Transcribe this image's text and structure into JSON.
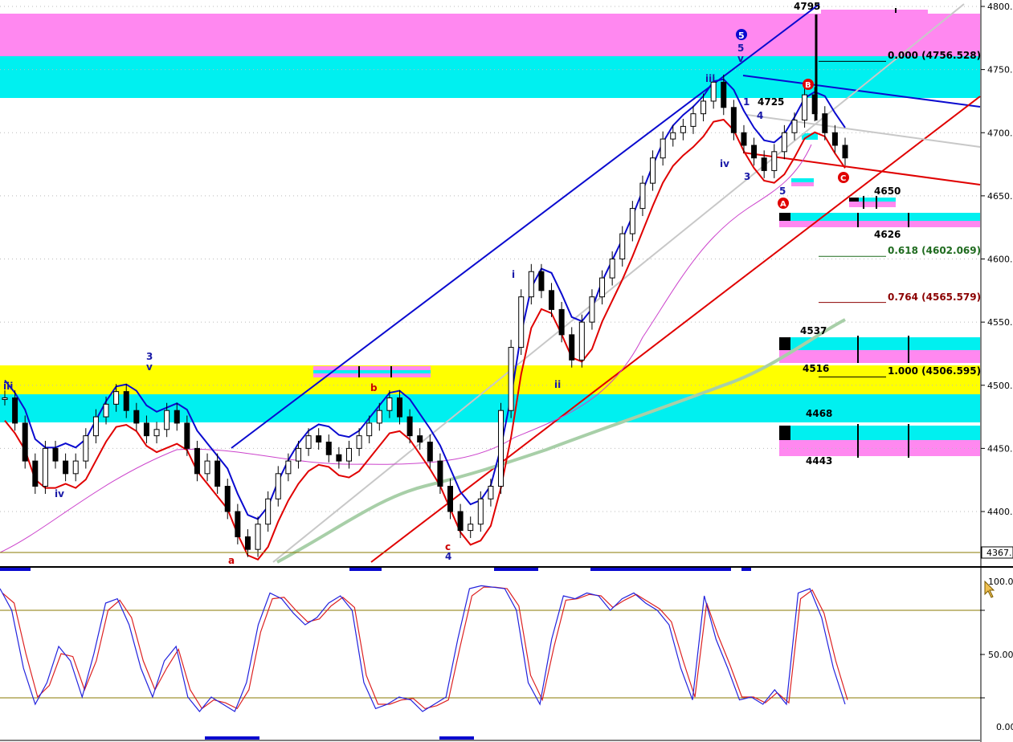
{
  "colors": {
    "magenta": "#ff88f0",
    "cyan": "#00f0f0",
    "yellow": "#ffff00",
    "blue_line": "#0a0acf",
    "red_line": "#e00000",
    "gray_line": "#b8b8b8",
    "green_ma": "#a8cfa8",
    "purple_ma": "#cc44cc",
    "stoch_k": "#2222dd",
    "stoch_d": "#dd2222",
    "ref_line": "#8a7a00"
  },
  "price_axis": {
    "ticks": [
      "4800.",
      "4750.",
      "4700.",
      "4650.",
      "4600.",
      "4550.",
      "4500.",
      "4450.",
      "4400."
    ],
    "current": "4367."
  },
  "osc_axis": {
    "ticks": [
      "100.0",
      "50.00",
      "0.00"
    ]
  },
  "fib_levels": [
    {
      "text": "0.000 (4756.528)",
      "value": 4756.528,
      "color": "#000000"
    },
    {
      "text": "0.618 (4602.069)",
      "value": 4602.069,
      "color": "#1f6b1f"
    },
    {
      "text": "0.764 (4565.579)",
      "value": 4565.579,
      "color": "#8b0000"
    },
    {
      "text": "1.000 (4506.595)",
      "value": 4506.595,
      "color": "#000000"
    }
  ],
  "price_labels": [
    "4795",
    "4725",
    "4650",
    "4626",
    "4537",
    "4516",
    "4468",
    "4443"
  ],
  "wave_labels": {
    "iii_left": "iii",
    "iv_left": "iv",
    "three_top": "3",
    "v_top": "v",
    "a_low": "a",
    "b_mid": "b",
    "c_low": "c",
    "four_low": "4",
    "i": "i",
    "ii": "ii",
    "iii": "iii",
    "five_top": "5",
    "v_right": "v",
    "circle5": "5",
    "iv_right": "iv",
    "one": "1",
    "four": "4",
    "three": "3",
    "five_low": "5",
    "A": "A",
    "B": "B",
    "C": "C"
  },
  "chart_data": {
    "type": "line",
    "title": "",
    "xlabel": "",
    "ylabel": "",
    "ylim": [
      4367,
      4810
    ],
    "osc_ylim": [
      0,
      100
    ],
    "series": [
      {
        "values": [
          4490,
          4470,
          4440,
          4420,
          4450,
          4440,
          4430,
          4440,
          4460,
          4475,
          4485,
          4495,
          4480,
          4470,
          4460,
          4465,
          4480,
          4470,
          4450,
          4430,
          4440,
          4420,
          4400,
          4380,
          4370,
          4390,
          4410,
          4430,
          4440,
          4450,
          4460,
          4455,
          4445,
          4440,
          4450,
          4460,
          4470,
          4480,
          4490,
          4475,
          4460,
          4455,
          4440,
          4420,
          4400,
          4385,
          4390,
          4410,
          4420,
          4480,
          4530,
          4570,
          4590,
          4575,
          4560,
          4540,
          4520,
          4550,
          4570,
          4585,
          4600,
          4620,
          4640,
          4660,
          4680,
          4695,
          4700,
          4705,
          4715,
          4725,
          4740,
          4720,
          4700,
          4690,
          4680,
          4670,
          4685,
          4700,
          4710,
          4730,
          4715,
          4700,
          4690,
          4680
        ]
      }
    ],
    "oscillator": {
      "k": [
        95,
        80,
        40,
        15,
        30,
        55,
        45,
        20,
        50,
        85,
        88,
        70,
        40,
        20,
        45,
        55,
        20,
        10,
        20,
        15,
        10,
        30,
        70,
        92,
        88,
        78,
        70,
        75,
        85,
        90,
        80,
        30,
        12,
        15,
        20,
        18,
        10,
        15,
        20,
        60,
        95,
        97,
        96,
        95,
        80,
        30,
        15,
        60,
        90,
        88,
        92,
        90,
        80,
        88,
        92,
        85,
        80,
        70,
        40,
        18,
        90,
        60,
        40,
        18,
        20,
        15,
        25,
        15,
        92,
        95,
        75,
        40,
        15
      ],
      "d": [
        92,
        85,
        50,
        20,
        28,
        50,
        48,
        25,
        45,
        80,
        87,
        75,
        45,
        25,
        40,
        53,
        25,
        12,
        18,
        16,
        12,
        25,
        65,
        88,
        89,
        80,
        72,
        74,
        83,
        89,
        82,
        35,
        15,
        15,
        18,
        19,
        12,
        14,
        18,
        55,
        90,
        96,
        96,
        95,
        83,
        35,
        18,
        55,
        87,
        88,
        91,
        90,
        82,
        87,
        91,
        86,
        81,
        72,
        45,
        20,
        85,
        62,
        42,
        20,
        20,
        16,
        23,
        16,
        88,
        94,
        78,
        45,
        18
      ]
    }
  }
}
